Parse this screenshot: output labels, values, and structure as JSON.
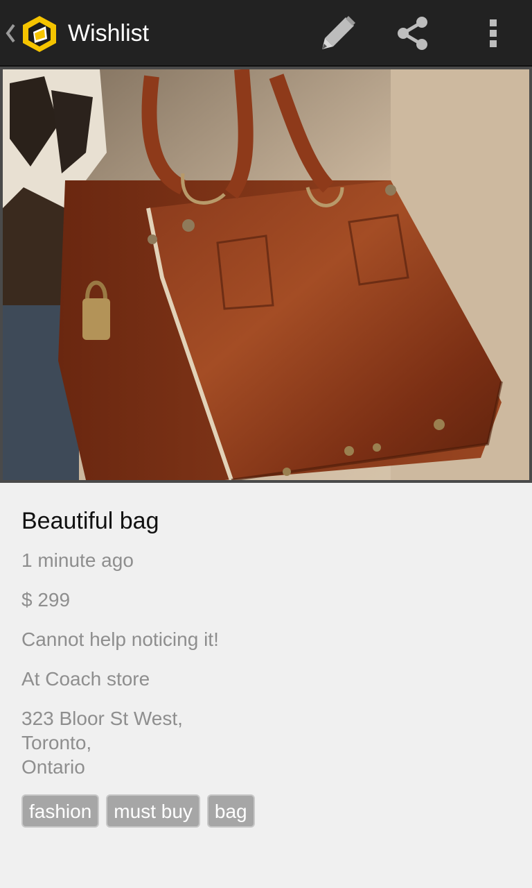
{
  "action_bar": {
    "title": "Wishlist",
    "icons": [
      "up-caret-icon",
      "app-logo-icon",
      "edit-pencil-icon",
      "share-icon",
      "overflow-menu-icon"
    ]
  },
  "item": {
    "title": "Beautiful bag",
    "time": "1 minute ago",
    "price": "$ 299",
    "note": "Cannot help noticing it!",
    "store": "At Coach store",
    "address": "323 Bloor St West,\nToronto,\nOntario",
    "tags": [
      "fashion",
      "must buy",
      "bag"
    ]
  },
  "colors": {
    "action_bar_bg": "#222222",
    "background": "#f0f0f0",
    "accent": "#f5c400",
    "tag_bg": "#a6a6a6"
  }
}
